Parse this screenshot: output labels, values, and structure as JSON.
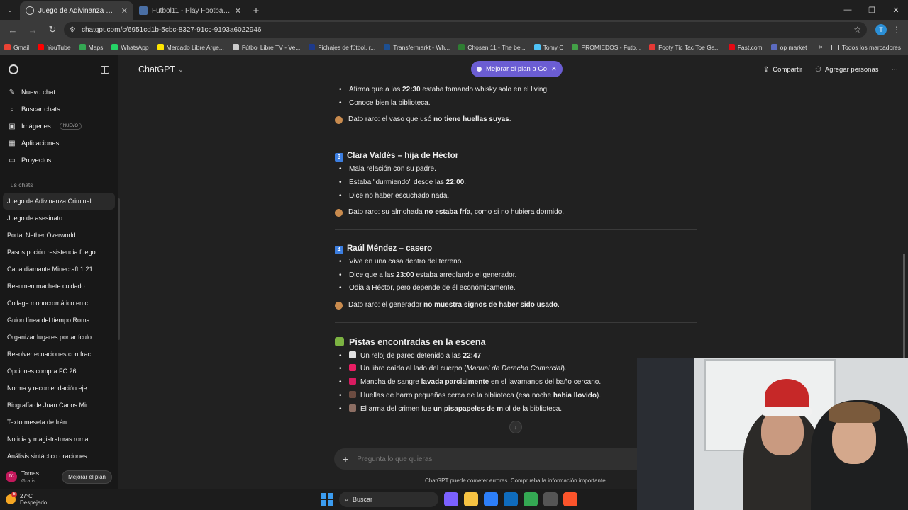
{
  "browser": {
    "tabs": [
      {
        "title": "Juego de Adivinanza Criminal",
        "active": true
      },
      {
        "title": "Futbol11 - Play Football 11",
        "active": false
      }
    ],
    "url": "chatgpt.com/c/6951cd1b-5cbc-8327-91cc-9193a6022946",
    "profile_initial": "T",
    "bookmarks": [
      {
        "label": "Gmail",
        "color": "#ea4335"
      },
      {
        "label": "YouTube",
        "color": "#ff0000"
      },
      {
        "label": "Maps",
        "color": "#34a853"
      },
      {
        "label": "WhatsApp",
        "color": "#25d366"
      },
      {
        "label": "Mercado Libre Arge...",
        "color": "#ffe600"
      },
      {
        "label": "Fútbol Libre TV - Ve...",
        "color": "#cccccc"
      },
      {
        "label": "Fichajes de fútbol, r...",
        "color": "#1e3a8a"
      },
      {
        "label": "Transfermarkt - Wh...",
        "color": "#1d4f91"
      },
      {
        "label": "Chosen 11 - The be...",
        "color": "#2e7d32"
      },
      {
        "label": "Tomy C",
        "color": "#4fc3f7"
      },
      {
        "label": "PROMIEDOS - Futb...",
        "color": "#43a047"
      },
      {
        "label": "Footy Tic Tac Toe Ga...",
        "color": "#e53935"
      },
      {
        "label": "Fast.com",
        "color": "#e50914"
      },
      {
        "label": "op market",
        "color": "#5c6bc0"
      }
    ],
    "bookmarks_folder": "Todos los marcadores"
  },
  "sidebar": {
    "nav": [
      {
        "label": "Nuevo chat",
        "icon": "edit-icon",
        "glyph": "✎"
      },
      {
        "label": "Buscar chats",
        "icon": "search-icon",
        "glyph": "⌕"
      },
      {
        "label": "Imágenes",
        "icon": "image-icon",
        "glyph": "▣",
        "badge": "NUEVO"
      },
      {
        "label": "Aplicaciones",
        "icon": "apps-icon",
        "glyph": "▦"
      },
      {
        "label": "Proyectos",
        "icon": "folder-icon",
        "glyph": "▭"
      }
    ],
    "section_title": "Tus chats",
    "chats": [
      "Juego de Adivinanza Criminal",
      "Juego de asesinato",
      "Portal Nether Overworld",
      "Pasos poción resistencia fuego",
      "Capa diamante Minecraft 1.21",
      "Resumen machete cuidado",
      "Collage monocromático en c...",
      "Guion línea del tiempo Roma",
      "Organizar lugares por artículo",
      "Resolver ecuaciones con frac...",
      "Opciones compra FC 26",
      "Norma y recomendación eje...",
      "Biografía de Juan Carlos Mir...",
      "Texto meseta de Irán",
      "Noticia y magistraturas roma...",
      "Análisis sintáctico oraciones"
    ],
    "user": {
      "initials": "TC",
      "name": "Tomas ...",
      "plan": "Gratis",
      "upgrade": "Mejorar el plan"
    }
  },
  "topbar": {
    "model": "ChatGPT",
    "promo": "Mejorar el plan a Go",
    "share": "Compartir",
    "add_people": "Agregar personas"
  },
  "content": {
    "top_bullets": [
      {
        "pre": "Afirma que a las ",
        "b": "22:30",
        "post": " estaba tomando whisky solo en el living."
      },
      {
        "pre": "Conoce bien la biblioteca.",
        "b": "",
        "post": ""
      }
    ],
    "top_note": {
      "pre": "Dato raro: el vaso que usó ",
      "b": "no tiene huellas suyas",
      "post": "."
    },
    "s3": {
      "num": "3",
      "title": "Clara Valdés – hija de Héctor",
      "bullets": [
        {
          "pre": "Mala relación con su padre.",
          "b": "",
          "post": ""
        },
        {
          "pre": "Estaba \"durmiendo\" desde las ",
          "b": "22:00",
          "post": "."
        },
        {
          "pre": "Dice no haber escuchado nada.",
          "b": "",
          "post": ""
        }
      ],
      "note": {
        "pre": "Dato raro: su almohada ",
        "b": "no estaba fría",
        "post": ", como si no hubiera dormido."
      }
    },
    "s4": {
      "num": "4",
      "title": "Raúl Méndez – casero",
      "bullets": [
        {
          "pre": "Vive en una casa dentro del terreno.",
          "b": "",
          "post": ""
        },
        {
          "pre": "Dice que a las ",
          "b": "23:00",
          "post": " estaba arreglando el generador."
        },
        {
          "pre": "Odia a Héctor, pero depende de él económicamente.",
          "b": "",
          "post": ""
        }
      ],
      "note": {
        "pre": "Dato raro: el generador ",
        "b": "no muestra signos de haber sido usado",
        "post": "."
      }
    },
    "clues": {
      "title": "Pistas encontradas en la escena",
      "items": [
        {
          "color": "#e0e0e0",
          "pre": "Un reloj de pared detenido a las ",
          "b": "22:47",
          "post": "."
        },
        {
          "color": "#e91e63",
          "pre": "Un libro caído al lado del cuerpo (",
          "it": "Manual de Derecho Comercial",
          "post": ")."
        },
        {
          "color": "#d81b60",
          "pre": "Mancha de sangre ",
          "b": "lavada parcialmente",
          "post": " en el lavamanos del baño cercano."
        },
        {
          "color": "#6d4c41",
          "pre": "Huellas de barro pequeñas cerca de la biblioteca (esa noche ",
          "b": "había llovido",
          "post": ")."
        },
        {
          "color": "#8d6e63",
          "pre": "El arma del crimen fue ",
          "b": "un pisapapeles de m",
          "post": " ol de la biblioteca."
        }
      ]
    }
  },
  "composer": {
    "placeholder": "Pregunta lo que quieras"
  },
  "disclaimer": "ChatGPT puede cometer errores. Comprueba la información importante.",
  "taskbar": {
    "temp": "27°C",
    "weather": "Despejado",
    "notif_count": "6",
    "search": "Buscar",
    "apps": [
      {
        "name": "copilot-icon",
        "color": "#7b61ff"
      },
      {
        "name": "file-explorer-icon",
        "color": "#f6c343"
      },
      {
        "name": "store-icon",
        "color": "#2d7ff9"
      },
      {
        "name": "outlook-icon",
        "color": "#0f6cbd"
      },
      {
        "name": "chrome-icon",
        "color": "#34a853"
      },
      {
        "name": "steam-icon",
        "color": "#555555"
      },
      {
        "name": "brave-icon",
        "color": "#fb542b"
      }
    ]
  }
}
